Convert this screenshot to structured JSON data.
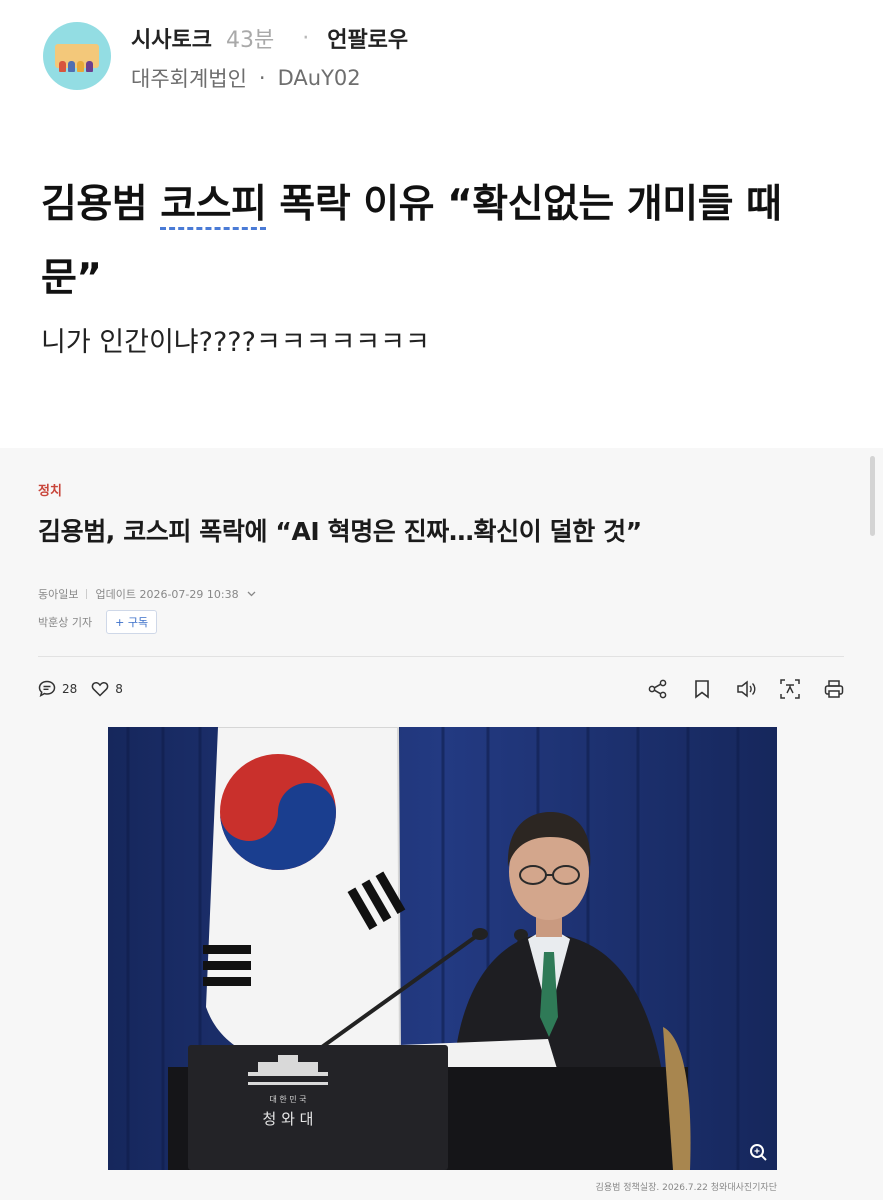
{
  "post": {
    "board": "시사토크",
    "time_ago": "43분",
    "separator": "·",
    "author": "언팔로우",
    "company": "대주회계법인",
    "dot": "·",
    "user_id": "DAuY02",
    "title_before": "김용범 ",
    "title_keyword": "코스피",
    "title_after": " 폭락 이유 “확신없는 개미들 때문”",
    "body": "니가 인간이냐????ㅋㅋㅋㅋㅋㅋㅋ"
  },
  "article": {
    "category": "정치",
    "headline": "김용범, 코스피 폭락에 “AI 혁명은 진짜…확신이 덜한 것”",
    "outlet": "동아일보",
    "updated": "업데이트 2026-07-29 10:38",
    "reporter": "박훈상 기자",
    "subscribe_label": "+ 구독",
    "comments_count": "28",
    "likes_count": "8",
    "photo_caption": "김용범 정책실장. 2026.7.22 청와대사진기자단"
  },
  "icons": [
    "comment-icon",
    "heart-icon",
    "share-icon",
    "bookmark-icon",
    "speaker-icon",
    "translate-icon",
    "print-icon",
    "zoom-icon"
  ],
  "colors": {
    "category": "#c8453a",
    "keyword_underline": "#4a7bd6",
    "subscribe": "#3b6fc9",
    "curtain": "#1d2f6b"
  }
}
